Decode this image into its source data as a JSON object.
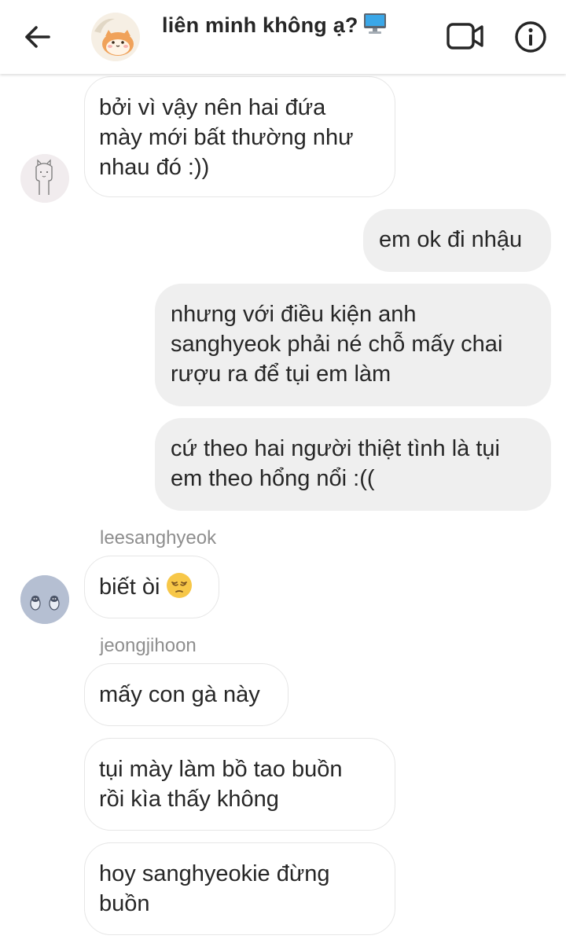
{
  "header": {
    "title": "liên minh không ạ?",
    "title_emoji": "desktop-computer-emoji"
  },
  "messages": [
    {
      "direction": "in",
      "lines": [
        "bởi vì vậy nên hai đứa",
        "mày mới bất thường như",
        "nhau đó :))"
      ]
    },
    {
      "direction": "out",
      "lines": [
        "em ok đi nhậu"
      ]
    },
    {
      "direction": "out",
      "lines": [
        "nhưng với điều kiện anh",
        "sanghyeok phải né chỗ mấy chai",
        "rượu ra để tụi em làm"
      ]
    },
    {
      "direction": "out",
      "lines": [
        "cứ theo hai người thiệt tình là tụi",
        "em theo hổng nổi :(("
      ]
    },
    {
      "direction": "in",
      "sender": "leesanghyeok",
      "lines": [
        "biết òi"
      ],
      "emoji": "pensive-face-emoji"
    },
    {
      "direction": "in",
      "sender": "jeongjihoon",
      "lines": [
        "mấy con gà này"
      ]
    },
    {
      "direction": "in",
      "lines": [
        "tụi mày làm bồ tao buồn",
        "rồi kìa thấy không"
      ]
    },
    {
      "direction": "in",
      "lines": [
        "hoy sanghyeokie đừng",
        "buồn"
      ]
    }
  ],
  "colors": {
    "text": "#262626",
    "secondary_text": "#8e8e8e",
    "outgoing_bubble": "#efefef",
    "incoming_border": "#e6e6e6",
    "background": "#ffffff"
  },
  "icons": {
    "back": "arrow-left-icon",
    "video": "video-camera-icon",
    "info": "info-icon"
  }
}
